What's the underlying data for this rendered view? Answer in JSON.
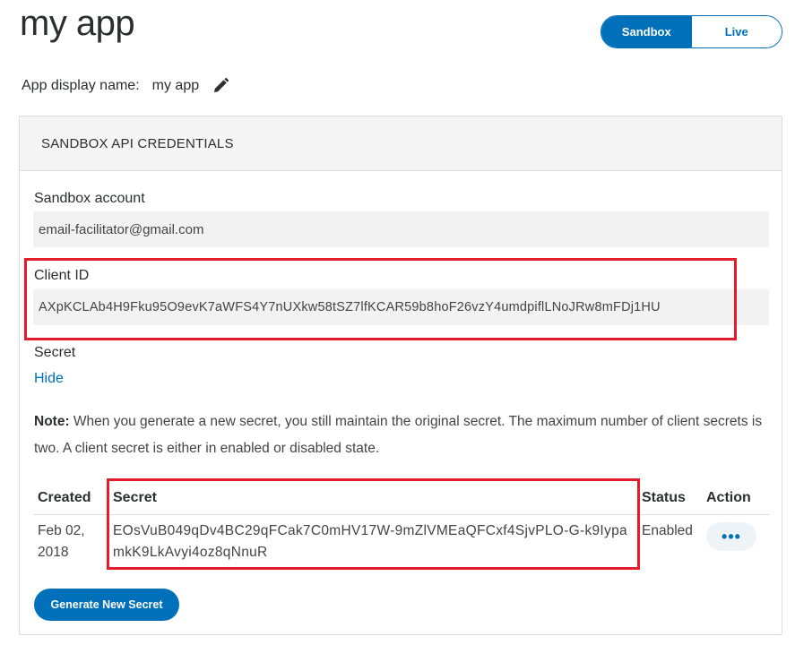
{
  "app": {
    "title": "my app"
  },
  "env_toggle": {
    "sandbox_label": "Sandbox",
    "live_label": "Live",
    "active": "Sandbox"
  },
  "display_name": {
    "label": "App display name:",
    "value": "my app",
    "edit_icon": "pencil-icon"
  },
  "card": {
    "header": "SANDBOX API CREDENTIALS",
    "sandbox_account": {
      "label": "Sandbox account",
      "value": "email-facilitator@gmail.com"
    },
    "client_id": {
      "label": "Client ID",
      "value": "AXpKCLAb4H9Fku95O9evK7aWFS4Y7nUXkw58tSZ7lfKCAR59b8hoF26vzY4umdpiflLNoJRw8mFDj1HU"
    },
    "secret": {
      "label": "Secret",
      "toggle_link": "Hide"
    },
    "note": {
      "prefix": "Note:",
      "text": " When you generate a new secret, you still maintain the original secret. The maximum number of client secrets is two. A client secret is either in enabled or disabled state."
    },
    "table": {
      "headers": {
        "created": "Created",
        "secret": "Secret",
        "status": "Status",
        "action": "Action"
      },
      "rows": [
        {
          "created": "Feb 02, 2018",
          "secret": "EOsVuB049qDv4BC29qFCak7C0mHV17W-9mZlVMEaQFCxf4SjvPLO-G-k9IypamkK9LkAvyi4oz8qNnuR",
          "status": "Enabled",
          "action_label": "•••"
        }
      ]
    },
    "generate_button": "Generate New Secret"
  },
  "colors": {
    "brand_blue": "#0070ba",
    "highlight_red": "#e41d2d",
    "field_bg": "#f2f2f2"
  }
}
